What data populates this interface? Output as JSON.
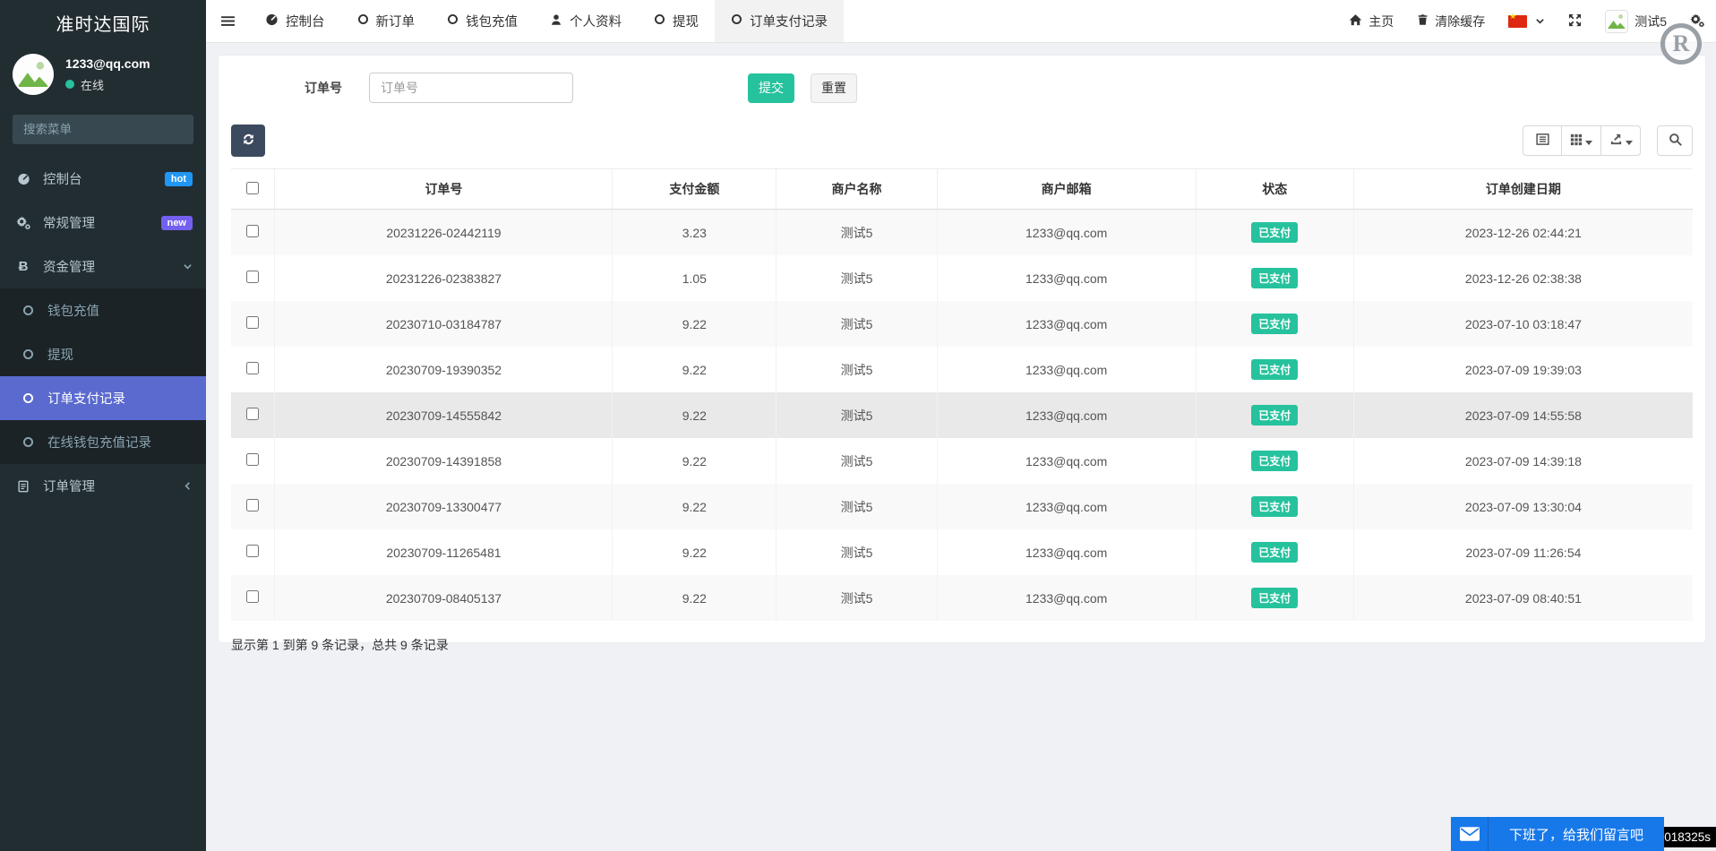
{
  "brand": {
    "title": "准时达国际"
  },
  "colors": {
    "accent_green": "#26c29d",
    "active_indigo": "#5a6acf",
    "hot_badge": "#2196f3",
    "new_badge": "#7460ee",
    "chat_blue": "#1778e9",
    "refresh_navy": "#3c4a5f",
    "flag_red": "#de2910"
  },
  "sidebar": {
    "search_placeholder": "搜索菜单",
    "user": {
      "email": "1233@qq.com",
      "status": "在线"
    },
    "items": [
      {
        "id": "dashboard",
        "label": "控制台",
        "icon": "gauge",
        "badge": {
          "text": "hot",
          "color": "#2196f3"
        }
      },
      {
        "id": "general-management",
        "label": "常规管理",
        "icon": "gears",
        "badge": {
          "text": "new",
          "color": "#7460ee"
        }
      },
      {
        "id": "funds-management",
        "label": "资金管理",
        "icon": "bitcoin",
        "chevron": "down",
        "children": [
          {
            "id": "wallet-recharge",
            "label": "钱包充值"
          },
          {
            "id": "withdraw",
            "label": "提现"
          },
          {
            "id": "order-payment-records",
            "label": "订单支付记录",
            "active": true
          },
          {
            "id": "online-wallet-recharge-records",
            "label": "在线钱包充值记录"
          }
        ]
      },
      {
        "id": "order-management",
        "label": "订单管理",
        "icon": "file",
        "chevron": "left"
      }
    ]
  },
  "topnav": {
    "tabs": [
      {
        "id": "dashboard",
        "label": "控制台",
        "icon": "gauge"
      },
      {
        "id": "new-order",
        "label": "新订单",
        "icon": "circle"
      },
      {
        "id": "wallet-recharge",
        "label": "钱包充值",
        "icon": "circle"
      },
      {
        "id": "profile",
        "label": "个人资料",
        "icon": "user"
      },
      {
        "id": "withdraw",
        "label": "提现",
        "icon": "circle"
      },
      {
        "id": "order-payment-records",
        "label": "订单支付记录",
        "icon": "circle",
        "active": true
      }
    ],
    "right": {
      "home": "主页",
      "clear_cache": "清除缓存",
      "username": "测试5"
    }
  },
  "filter": {
    "label": "订单号",
    "placeholder": "订单号",
    "submit": "提交",
    "reset": "重置"
  },
  "toolbar": {
    "buttons": [
      {
        "id": "toggle-view",
        "icon": "listview",
        "caret": false
      },
      {
        "id": "columns",
        "icon": "grid",
        "caret": true
      },
      {
        "id": "export",
        "icon": "export",
        "caret": true
      }
    ]
  },
  "table": {
    "columns": [
      "订单号",
      "支付金额",
      "商户名称",
      "商户邮箱",
      "状态",
      "订单创建日期"
    ],
    "highlighted_row_index": 4,
    "rows": [
      {
        "order_no": "20231226-02442119",
        "amount": "3.23",
        "merchant": "测试5",
        "email": "1233@qq.com",
        "status": "已支付",
        "created": "2023-12-26 02:44:21"
      },
      {
        "order_no": "20231226-02383827",
        "amount": "1.05",
        "merchant": "测试5",
        "email": "1233@qq.com",
        "status": "已支付",
        "created": "2023-12-26 02:38:38"
      },
      {
        "order_no": "20230710-03184787",
        "amount": "9.22",
        "merchant": "测试5",
        "email": "1233@qq.com",
        "status": "已支付",
        "created": "2023-07-10 03:18:47"
      },
      {
        "order_no": "20230709-19390352",
        "amount": "9.22",
        "merchant": "测试5",
        "email": "1233@qq.com",
        "status": "已支付",
        "created": "2023-07-09 19:39:03"
      },
      {
        "order_no": "20230709-14555842",
        "amount": "9.22",
        "merchant": "测试5",
        "email": "1233@qq.com",
        "status": "已支付",
        "created": "2023-07-09 14:55:58"
      },
      {
        "order_no": "20230709-14391858",
        "amount": "9.22",
        "merchant": "测试5",
        "email": "1233@qq.com",
        "status": "已支付",
        "created": "2023-07-09 14:39:18"
      },
      {
        "order_no": "20230709-13300477",
        "amount": "9.22",
        "merchant": "测试5",
        "email": "1233@qq.com",
        "status": "已支付",
        "created": "2023-07-09 13:30:04"
      },
      {
        "order_no": "20230709-11265481",
        "amount": "9.22",
        "merchant": "测试5",
        "email": "1233@qq.com",
        "status": "已支付",
        "created": "2023-07-09 11:26:54"
      },
      {
        "order_no": "20230709-08405137",
        "amount": "9.22",
        "merchant": "测试5",
        "email": "1233@qq.com",
        "status": "已支付",
        "created": "2023-07-09 08:40:51"
      }
    ],
    "summary": "显示第 1 到第 9 条记录，总共 9 条记录"
  },
  "chat": {
    "message": "下班了，给我们留言吧"
  },
  "timer": {
    "text": "018325s"
  },
  "watermark": {
    "text": "R"
  }
}
